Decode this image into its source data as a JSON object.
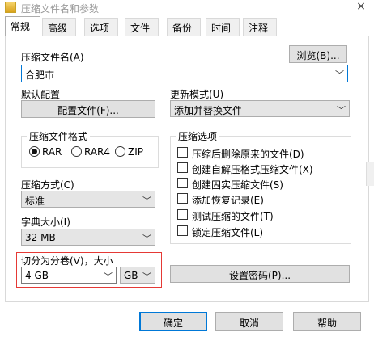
{
  "window": {
    "title": "压缩文件名和参数",
    "close_glyph": "×"
  },
  "tabs": [
    {
      "label": "常规",
      "active": true
    },
    {
      "label": "高级"
    },
    {
      "label": "选项"
    },
    {
      "label": "文件"
    },
    {
      "label": "备份"
    },
    {
      "label": "时间"
    },
    {
      "label": "注释"
    }
  ],
  "archive": {
    "name_label": "压缩文件名(A)",
    "browse_button": "浏览(B)...",
    "name_value": "合肥市"
  },
  "profiles": {
    "label": "默认配置",
    "button": "配置文件(F)..."
  },
  "update_mode": {
    "label": "更新模式(U)",
    "value": "添加并替换文件"
  },
  "format": {
    "label": "压缩文件格式",
    "options": [
      "RAR",
      "RAR4",
      "ZIP"
    ],
    "selected": "RAR"
  },
  "archive_options": {
    "label": "压缩选项",
    "items": [
      "压缩后删除原来的文件(D)",
      "创建自解压格式压缩文件(X)",
      "创建固实压缩文件(S)",
      "添加恢复记录(E)",
      "测试压缩的文件(T)",
      "锁定压缩文件(L)"
    ]
  },
  "method": {
    "label": "压缩方式(C)",
    "value": "标准"
  },
  "dictionary": {
    "label": "字典大小(I)",
    "value": "32 MB"
  },
  "split": {
    "label": "切分为分卷(V)，大小",
    "size": "4 GB",
    "unit": "GB"
  },
  "set_password_button": "设置密码(P)...",
  "footer": {
    "ok": "确定",
    "cancel": "取消",
    "help": "帮助"
  },
  "icons": {
    "dropdown": "chevron-down-icon"
  },
  "colors": {
    "accent": "#0078d7",
    "highlight_box": "#e53935"
  }
}
